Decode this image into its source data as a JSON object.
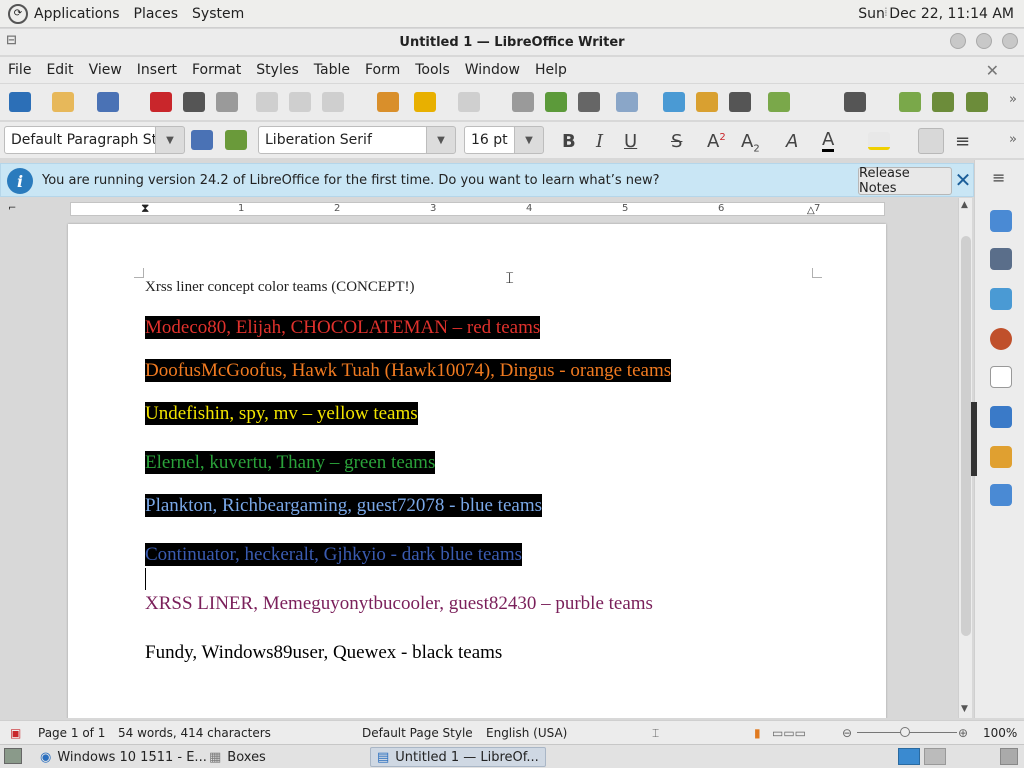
{
  "top_panel": {
    "menus": [
      "Applications",
      "Places",
      "System"
    ],
    "clock": "Sun Dec 22, 11:14 AM"
  },
  "window": {
    "title": "Untitled 1 — LibreOffice Writer"
  },
  "menubar": [
    "File",
    "Edit",
    "View",
    "Insert",
    "Format",
    "Styles",
    "Table",
    "Form",
    "Tools",
    "Window",
    "Help"
  ],
  "formatting": {
    "paragraph_style": "Default Paragraph Style",
    "font_name": "Liberation Serif",
    "font_size": "16 pt"
  },
  "infobar": {
    "message": "You are running version 24.2 of LibreOffice for the first time. Do you want to learn what’s new?",
    "button": "Release Notes"
  },
  "ruler": {
    "numbers": [
      "1",
      "2",
      "3",
      "4",
      "5",
      "6",
      "7"
    ]
  },
  "document": {
    "lines": [
      {
        "text": "Xrss liner concept color teams (CONCEPT!)",
        "color": "#000000",
        "highlight": false
      },
      {
        "text": "Modeco80, Elijah, CHOCOLATEMAN – red teams",
        "color": "#e0312c",
        "highlight": true
      },
      {
        "text": "DoofusMcGoofus, Hawk  Tuah (Hawk10074), Dingus - orange teams",
        "color": "#f07a20",
        "highlight": true
      },
      {
        "text": "Undefishin, spy, mv – yellow teams",
        "color": "#f2e400",
        "highlight": true
      },
      {
        "text": "Elernel, kuvertu, Thany – green teams",
        "color": "#2aa23a",
        "highlight": true
      },
      {
        "text": "Plankton, Richbeargaming, guest72078 - blue teams",
        "color": "#7aa8e8",
        "highlight": true
      },
      {
        "text": "Continuator, heckeralt, Gjhkyio - dark blue teams",
        "color": "#3a5bb0",
        "highlight": true
      },
      {
        "text": "XRSS LINER, Memeguyonytbucooler, guest82430 – purble teams",
        "color": "#7a1f5a",
        "highlight": false
      },
      {
        "text": "Fundy, Windows89user, Quewex - black teams",
        "color": "#000000",
        "highlight": false
      }
    ]
  },
  "statusbar": {
    "page": "Page 1 of 1",
    "words": "54 words, 414 characters",
    "page_style": "Default Page Style",
    "language": "English (USA)",
    "zoom": "100%"
  },
  "taskbar": {
    "items": [
      {
        "label": "Windows 10 1511 - E...",
        "active": false
      },
      {
        "label": "Boxes",
        "active": false
      },
      {
        "label": "Untitled 1 — LibreOf...",
        "active": true
      }
    ]
  }
}
